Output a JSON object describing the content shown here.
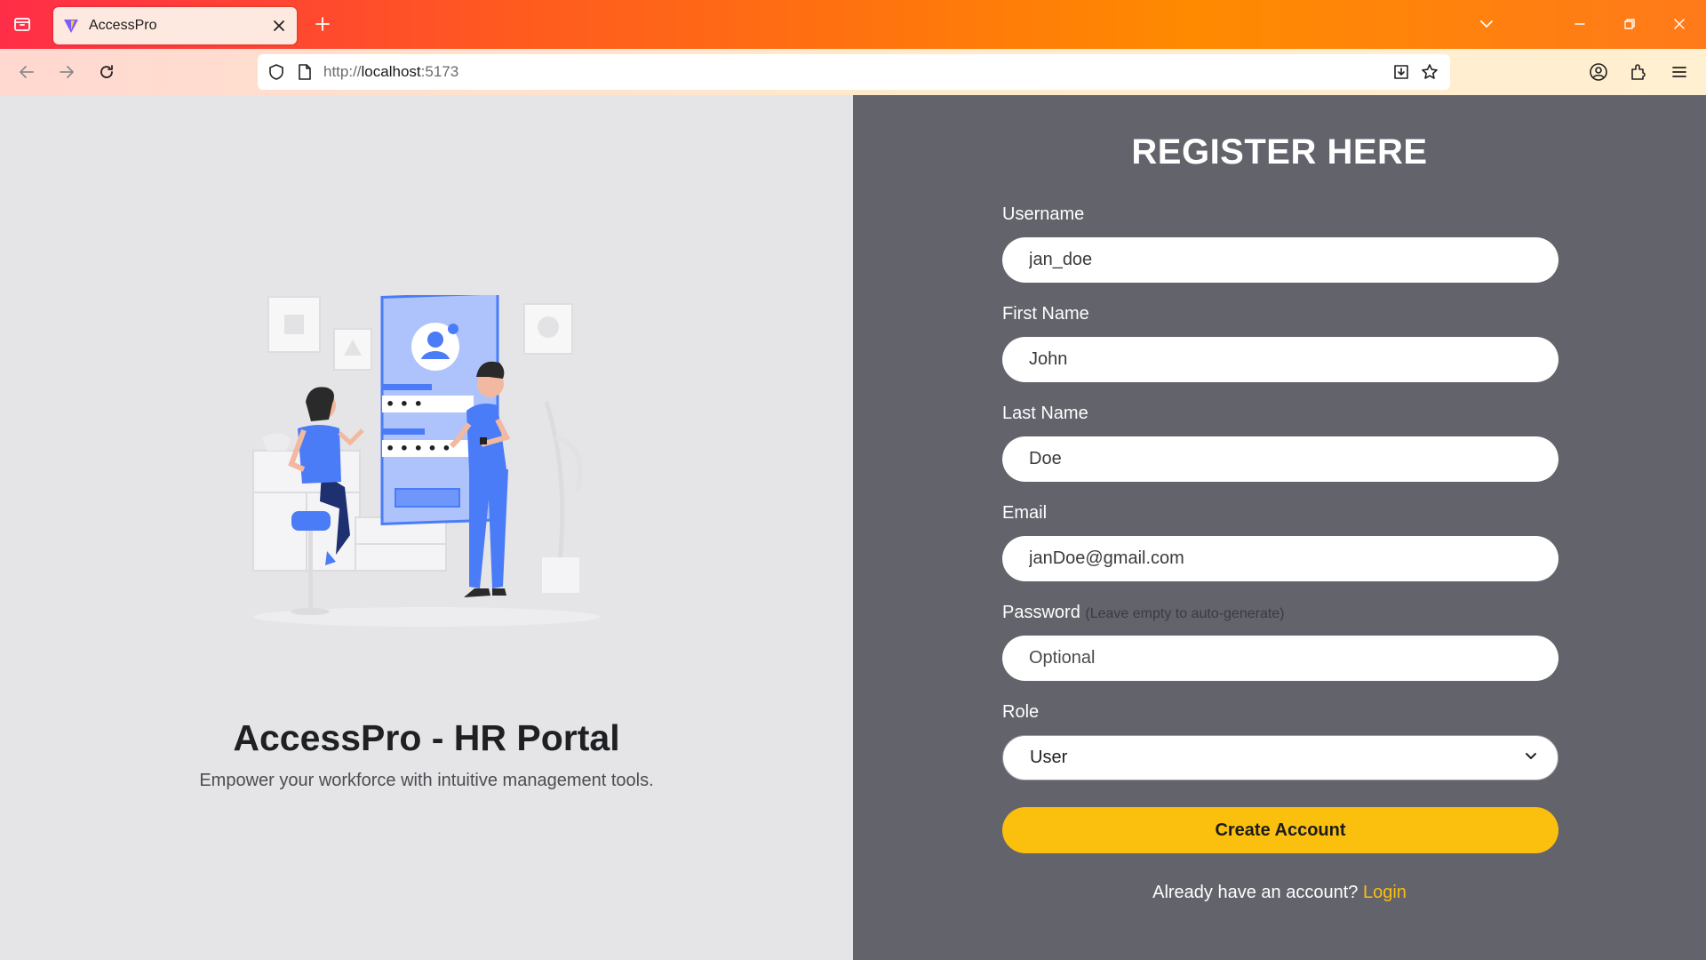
{
  "browser": {
    "tab_title": "AccessPro",
    "url_scheme": "http://",
    "url_host": "localhost",
    "url_port": ":5173"
  },
  "hero": {
    "title": "AccessPro - HR Portal",
    "subtitle": "Empower your workforce with intuitive management tools.",
    "illustration_password_dots_1": "• • •",
    "illustration_password_dots_2": "• • • • •"
  },
  "form": {
    "heading": "REGISTER HERE",
    "username": {
      "label": "Username",
      "value": "jan_doe"
    },
    "first_name": {
      "label": "First Name",
      "value": "John"
    },
    "last_name": {
      "label": "Last Name",
      "value": "Doe"
    },
    "email": {
      "label": "Email",
      "value": "janDoe@gmail.com"
    },
    "password": {
      "label": "Password",
      "hint": "(Leave empty to auto-generate)",
      "placeholder": "Optional",
      "value": ""
    },
    "role": {
      "label": "Role",
      "selected": "User"
    },
    "submit_label": "Create Account",
    "login_prompt": "Already have an account?",
    "login_link": "Login"
  },
  "colors": {
    "accent": "#fbbf0e",
    "right_panel": "#62636b",
    "left_panel": "#e5e5e7",
    "illustration_blue": "#4a7cf7"
  },
  "icons": {
    "tab_list": "tab-list-icon",
    "favicon": "vite-favicon-icon",
    "tab_close": "close-icon",
    "new_tab": "plus-icon",
    "back": "arrow-left-icon",
    "forward": "arrow-right-icon",
    "reload": "reload-icon",
    "shield": "shield-icon",
    "page": "page-icon",
    "save_page": "download-icon",
    "bookmark": "star-icon",
    "account": "account-icon",
    "extensions": "puzzle-icon",
    "menu": "hamburger-menu-icon",
    "role_dropdown": "chevron-down-icon"
  }
}
